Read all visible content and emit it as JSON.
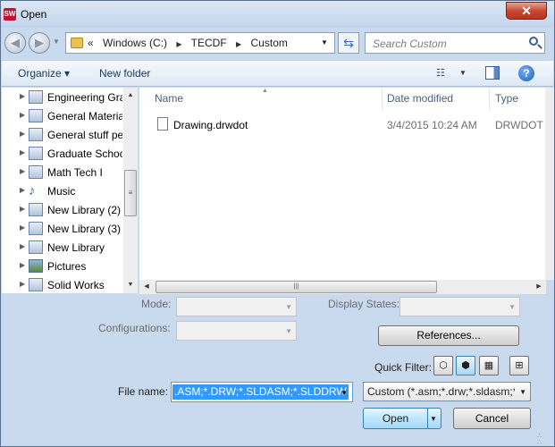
{
  "window": {
    "title": "Open",
    "app_icon_text": "SW",
    "close_glyph": "✕"
  },
  "nav": {
    "back_glyph": "◀",
    "forward_glyph": "▶",
    "prefix": "«",
    "breadcrumbs": [
      "Windows (C:)",
      "TECDF",
      "Custom"
    ],
    "refresh_glyph": "⇆",
    "search_placeholder": "Search Custom"
  },
  "toolbar": {
    "organize": "Organize ▾",
    "new_folder": "New folder",
    "view_glyph": "☷",
    "help_glyph": "?"
  },
  "tree": {
    "items": [
      {
        "label": "Engineering Gra",
        "icon": "library-icon"
      },
      {
        "label": "General Materia",
        "icon": "library-icon"
      },
      {
        "label": "General stuff pe",
        "icon": "library-icon"
      },
      {
        "label": "Graduate Schoo",
        "icon": "library-icon"
      },
      {
        "label": "Math Tech I",
        "icon": "library-icon"
      },
      {
        "label": "Music",
        "icon": "music-icon"
      },
      {
        "label": "New Library (2)",
        "icon": "library-icon"
      },
      {
        "label": "New Library (3)",
        "icon": "library-icon"
      },
      {
        "label": "New Library",
        "icon": "library-icon"
      },
      {
        "label": "Pictures",
        "icon": "pictures-icon"
      },
      {
        "label": "Solid Works",
        "icon": "library-icon"
      }
    ]
  },
  "files": {
    "columns": {
      "name": "Name",
      "date": "Date modified",
      "type": "Type"
    },
    "rows": [
      {
        "name": "Drawing.drwdot",
        "date": "3/4/2015 10:24 AM",
        "type": "DRWDOT F"
      }
    ]
  },
  "options": {
    "mode_label": "Mode:",
    "configurations_label": "Configurations:",
    "display_states_label": "Display States:",
    "references_button": "References...",
    "quick_filter_label": "Quick Filter:"
  },
  "bottom": {
    "file_name_label": "File name:",
    "file_name_value": ".ASM;*.DRW;*.SLDASM;*.SLDDRW",
    "filter_value": "Custom (*.asm;*.drw;*.sldasm;*",
    "open_button": "Open",
    "cancel_button": "Cancel"
  }
}
